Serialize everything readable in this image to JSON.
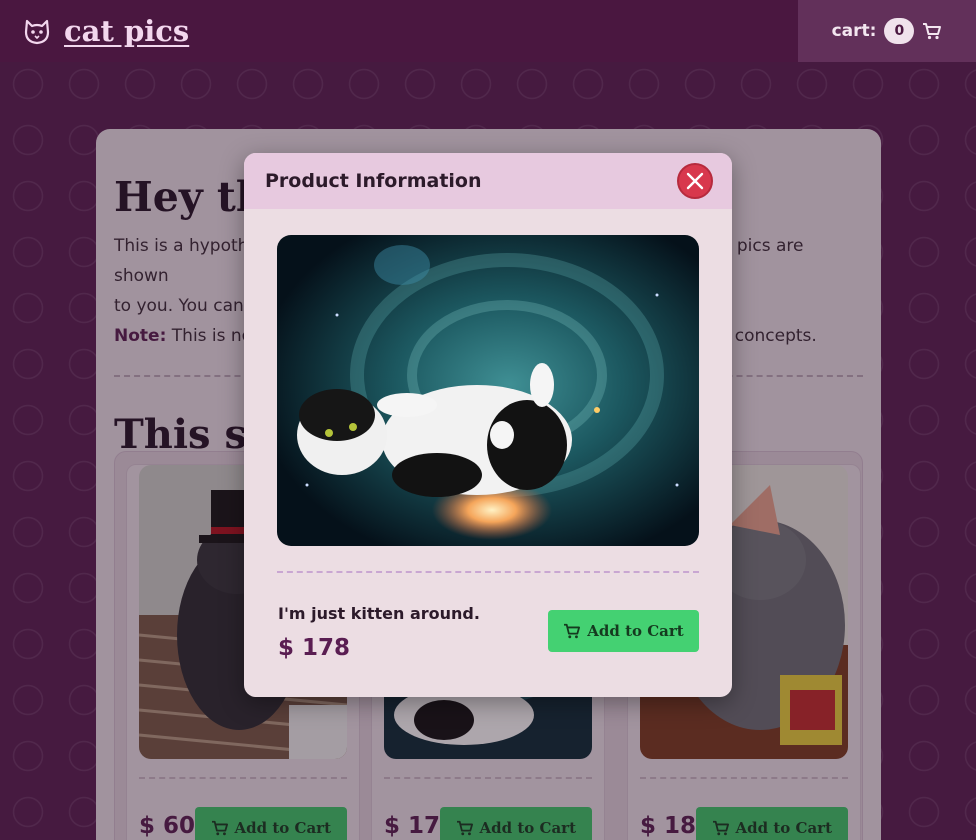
{
  "header": {
    "brand_name": "cat pics",
    "cart_label": "cart:",
    "cart_count": "0",
    "logo_icon": "cat-face-icon",
    "cart_icon": "shopping-cart-icon"
  },
  "main": {
    "heading_visible": "Hey th",
    "intro_line1_left": "This is a hypothe",
    "intro_line1_right": "pics are shown",
    "intro_line2_left": "to you. You can a",
    "note_label": "Note:",
    "note_text_left": "This is not",
    "note_text_right": "concepts.",
    "section_heading_visible": "This se"
  },
  "products": [
    {
      "price": "$ 60",
      "button": "Add to Cart"
    },
    {
      "price": "$ 178",
      "button": "Add to Cart"
    },
    {
      "price": "$ 184",
      "button": "Add to Cart"
    }
  ],
  "modal": {
    "title": "Product Information",
    "description": "I'm just kitten around.",
    "price": "$ 178",
    "button": "Add to Cart",
    "close_icon": "close-x-icon"
  },
  "colors": {
    "accent": "#5a1d52",
    "button_green": "#44d172",
    "close_red": "#d8384d",
    "modal_header": "#e7c9df"
  }
}
